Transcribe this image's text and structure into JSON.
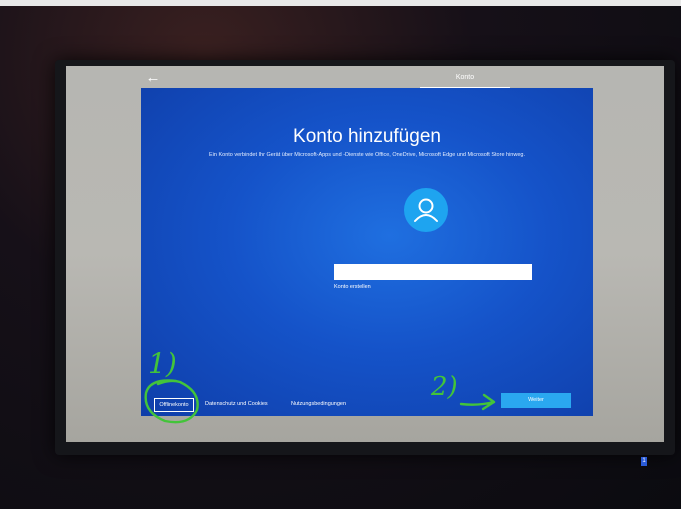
{
  "window": {
    "tab_label": "Konto",
    "back_icon": "back-arrow-icon"
  },
  "main": {
    "title": "Konto hinzufügen",
    "subtitle": "Ein Konto verbindet Ihr Gerät über Microsoft-Apps und -Dienste wie Office, OneDrive, Microsoft Edge und Microsoft Store hinweg.",
    "avatar_icon": "user-icon",
    "email_value": "",
    "create_account_link": "Konto erstellen"
  },
  "footer": {
    "offline_account": "Offlinekonto",
    "privacy": "Datenschutz und Cookies",
    "terms": "Nutzungsbedingungen",
    "next": "Weiter"
  },
  "annotations": {
    "step1": "1)",
    "step2": "2)",
    "color": "#43c43a"
  },
  "taskbar": {
    "badge": "1"
  },
  "colors": {
    "panel_blue": "#1553c9",
    "accent": "#2aa8f0",
    "avatar": "#1ea4f0"
  }
}
